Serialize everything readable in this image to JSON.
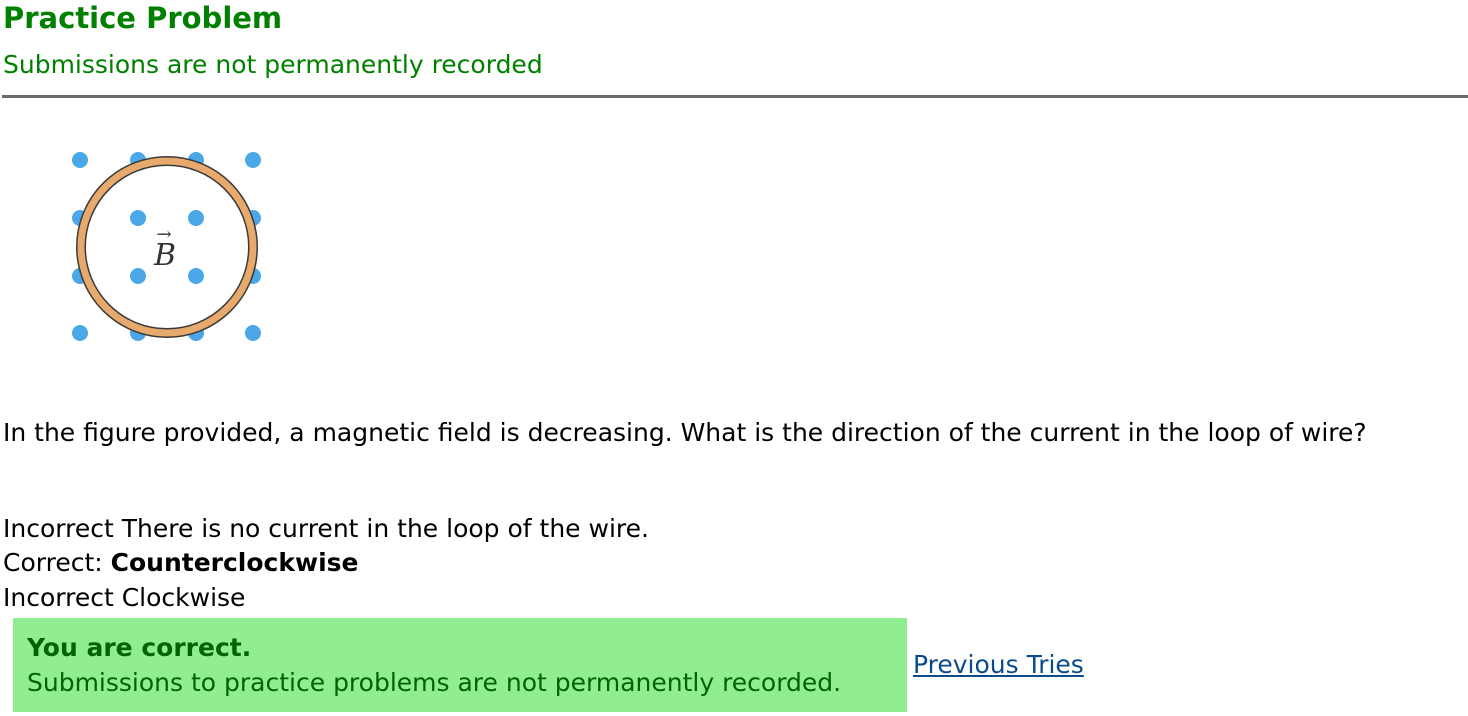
{
  "header": {
    "title": "Practice Problem",
    "subtitle": "Submissions are not permanently recorded"
  },
  "figure": {
    "field_label": "B",
    "field_vector_arrow": "→",
    "icon": "magnetic-field-loop-figure",
    "colors": {
      "field_dot": "#4ba7e8",
      "loop_ring": "#e8a96c",
      "loop_outline": "#3a3a3a"
    }
  },
  "question": {
    "text": "In the figure provided, a magnetic field is decreasing. What is the direction of the current in the loop of wire?"
  },
  "choices": [
    {
      "status": "Incorrect",
      "separator": " ",
      "text": "There is no current in the loop of the wire."
    },
    {
      "status": "Correct:",
      "separator": " ",
      "text": "Counterclockwise"
    },
    {
      "status": "Incorrect",
      "separator": " ",
      "text": "Clockwise"
    }
  ],
  "feedback": {
    "title": "You are correct.",
    "message": "Submissions to practice problems are not permanently recorded.",
    "background": "#90ee90"
  },
  "links": {
    "previous_tries": "Previous Tries"
  }
}
